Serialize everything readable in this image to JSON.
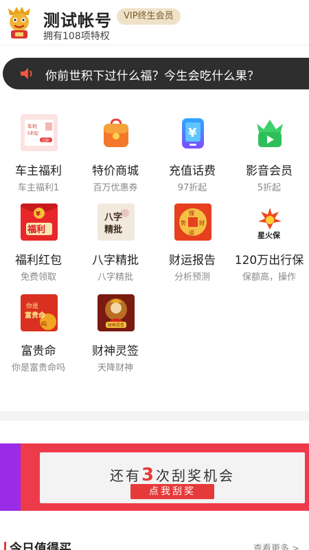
{
  "header": {
    "account_name": "测试帐号",
    "vip_badge": "VIP终生会员",
    "privilege_text": "拥有108项特权"
  },
  "notice": {
    "text": "你前世积下过什么福？今生会吃什么果？"
  },
  "grid": [
    {
      "label": "车主福利",
      "sub": "车主福利1",
      "icon": "car-owner-icon"
    },
    {
      "label": "特价商城",
      "sub": "百万优惠券",
      "icon": "shopping-bag-icon"
    },
    {
      "label": "充值话费",
      "sub": "97折起",
      "icon": "phone-recharge-icon"
    },
    {
      "label": "影音会员",
      "sub": "5折起",
      "icon": "video-crown-icon"
    },
    {
      "label": "福利红包",
      "sub": "免费领取",
      "icon": "red-envelope-icon"
    },
    {
      "label": "八字精批",
      "sub": "八字精批",
      "icon": "bazi-icon"
    },
    {
      "label": "财运报告",
      "sub": "分析预测",
      "icon": "fortune-report-icon"
    },
    {
      "label": "120万出行保",
      "sub": "保额高，操作",
      "icon": "travel-insurance-icon"
    },
    {
      "label": "富贵命",
      "sub": "你是富贵命吗",
      "icon": "rich-fate-icon"
    },
    {
      "label": "财神灵签",
      "sub": "天降财神",
      "icon": "wealth-god-icon"
    }
  ],
  "icon_text": {
    "car": "车利",
    "car_small": "5折起",
    "car_btn": "立即",
    "envelope": "福利",
    "bazi": "八字精批",
    "fortune": "理财运财",
    "travel": "星火保",
    "rich_fate": "你是富贵命吗",
    "wealth_god": "财神灵签"
  },
  "banner": {
    "text_before": "还有",
    "count": "3",
    "text_after": "次刮奖机会",
    "button": "点我刮奖"
  },
  "bottom": {
    "title": "今日值得买",
    "more": "查看更多 >"
  },
  "colors": {
    "accent_red": "#e63a3a",
    "notice_bg": "#2e2e2e",
    "vip_bg": "#efe2c9",
    "banner_purple": "#9a2be6"
  }
}
